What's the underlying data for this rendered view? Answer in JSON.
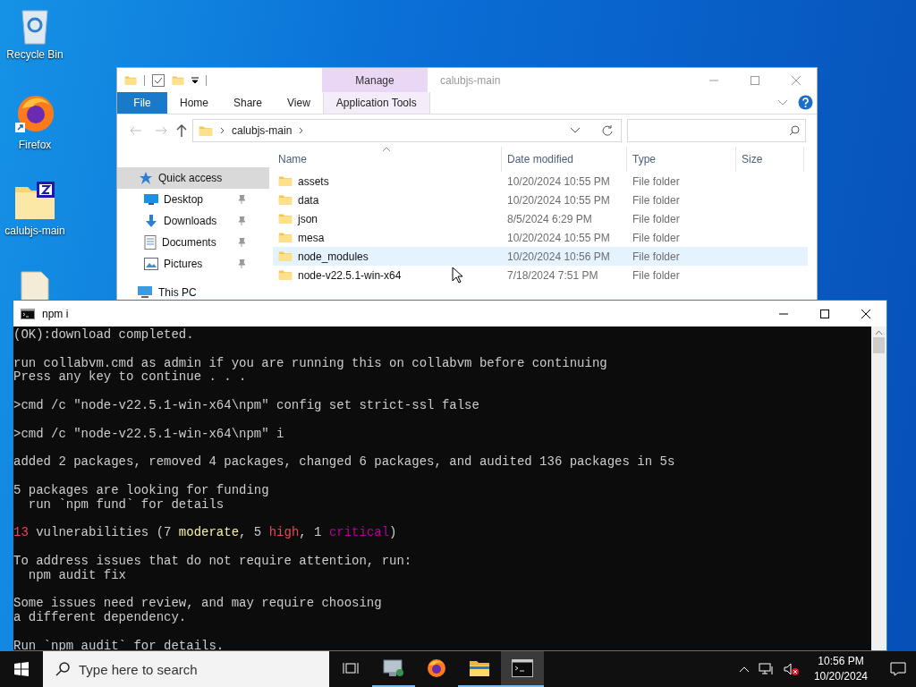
{
  "desktop_icons": [
    {
      "label": "Recycle Bin",
      "kind": "recycle-bin"
    },
    {
      "label": "Firefox",
      "kind": "firefox"
    },
    {
      "label": "calubjs-main",
      "kind": "zip-folder"
    },
    {
      "kind": "file"
    }
  ],
  "explorer": {
    "title": "calubjs-main",
    "context_group": "Manage",
    "ribbon_tabs": [
      {
        "label": "File",
        "kind": "file"
      },
      {
        "label": "Home",
        "kind": "tab"
      },
      {
        "label": "Share",
        "kind": "tab"
      },
      {
        "label": "View",
        "kind": "tab"
      },
      {
        "label": "Application Tools",
        "kind": "context"
      }
    ],
    "address": [
      "calubjs-main"
    ],
    "nav": [
      {
        "label": "Quick access",
        "kind": "star",
        "selected": true,
        "pinned": false
      },
      {
        "label": "Desktop",
        "kind": "desktop",
        "selected": false,
        "pinned": true
      },
      {
        "label": "Downloads",
        "kind": "download",
        "selected": false,
        "pinned": true
      },
      {
        "label": "Documents",
        "kind": "document",
        "selected": false,
        "pinned": true
      },
      {
        "label": "Pictures",
        "kind": "picture",
        "selected": false,
        "pinned": true
      },
      {
        "label": "This PC",
        "kind": "pc",
        "selected": false,
        "pinned": false
      }
    ],
    "columns": [
      "Name",
      "Date modified",
      "Type",
      "Size"
    ],
    "rows": [
      {
        "name": "assets",
        "date": "10/20/2024 10:55 PM",
        "type": "File folder",
        "hovered": false
      },
      {
        "name": "data",
        "date": "10/20/2024 10:55 PM",
        "type": "File folder",
        "hovered": false
      },
      {
        "name": "json",
        "date": "8/5/2024 6:29 PM",
        "type": "File folder",
        "hovered": false
      },
      {
        "name": "mesa",
        "date": "10/20/2024 10:55 PM",
        "type": "File folder",
        "hovered": false
      },
      {
        "name": "node_modules",
        "date": "10/20/2024 10:56 PM",
        "type": "File folder",
        "hovered": true
      },
      {
        "name": "node-v22.5.1-win-x64",
        "date": "7/18/2024 7:51 PM",
        "type": "File folder",
        "hovered": false
      }
    ]
  },
  "console": {
    "title": "npm i",
    "blocks": [
      [
        "(OK):download completed."
      ],
      [
        "run collabvm.cmd as admin if you are running this on collabvm before continuing",
        "Press any key to continue . . ."
      ],
      [
        ">cmd /c \"node-v22.5.1-win-x64\\npm\" config set strict-ssl false"
      ],
      [
        ">cmd /c \"node-v22.5.1-win-x64\\npm\" i"
      ],
      [
        "added 2 packages, removed 4 packages, changed 6 packages, and audited 136 packages in 5s"
      ],
      [
        "5 packages are looking for funding",
        "  run `npm fund` for details"
      ],
      [
        {
          "segments": [
            {
              "text": "13",
              "color": "#e74856"
            },
            {
              "text": " vulnerabilities (7 "
            },
            {
              "text": "moderate",
              "color": "#f9f1a5"
            },
            {
              "text": ", 5 "
            },
            {
              "text": "high",
              "color": "#e74856"
            },
            {
              "text": ", 1 "
            },
            {
              "text": "critical",
              "color": "#b4009e"
            },
            {
              "text": ")"
            }
          ]
        }
      ],
      [
        "To address issues that do not require attention, run:",
        "  npm audit fix"
      ],
      [
        "Some issues need review, and may require choosing",
        "a different dependency."
      ],
      [
        "Run `npm audit` for details."
      ]
    ]
  },
  "taskbar": {
    "search_placeholder": "Type here to search",
    "apps": [
      {
        "kind": "network-app",
        "open": true,
        "active": false
      },
      {
        "kind": "firefox",
        "open": false,
        "active": false
      },
      {
        "kind": "explorer",
        "open": true,
        "active": false
      },
      {
        "kind": "terminal",
        "open": true,
        "active": true
      }
    ],
    "clock": {
      "time": "10:56 PM",
      "date": "10/20/2024"
    }
  }
}
